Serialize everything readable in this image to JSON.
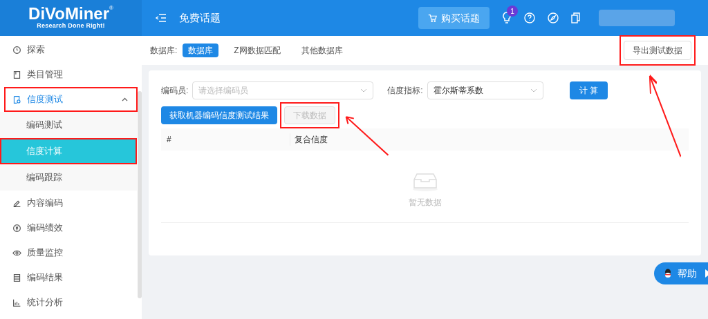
{
  "logo": {
    "name": "DiVoMiner",
    "mark": "®",
    "tagline": "Research Done Right!"
  },
  "header": {
    "title": "免费话题",
    "buy_button": "购买话题",
    "notification_count": "1"
  },
  "sidebar": {
    "items": [
      {
        "label": "探索",
        "selected": false,
        "highlighted": false
      },
      {
        "label": "类目管理",
        "selected": false,
        "highlighted": false
      },
      {
        "label": "信度测试",
        "selected": false,
        "highlighted": true,
        "expanded": true,
        "children": [
          {
            "label": "编码测试",
            "selected": false,
            "highlighted": false
          },
          {
            "label": "信度计算",
            "selected": true,
            "highlighted": true
          },
          {
            "label": "编码跟踪",
            "selected": false,
            "highlighted": false
          }
        ]
      },
      {
        "label": "内容编码",
        "selected": false,
        "highlighted": false
      },
      {
        "label": "编码绩效",
        "selected": false,
        "highlighted": false
      },
      {
        "label": "质量监控",
        "selected": false,
        "highlighted": false
      },
      {
        "label": "编码结果",
        "selected": false,
        "highlighted": false
      },
      {
        "label": "统计分析",
        "selected": false,
        "highlighted": false
      }
    ]
  },
  "database_bar": {
    "label": "数据库:",
    "options": [
      {
        "label": "数据库",
        "selected": true
      },
      {
        "label": "Z网数据匹配",
        "selected": false
      },
      {
        "label": "其他数据库",
        "selected": false
      }
    ],
    "export_button": {
      "label": "导出测试数据",
      "highlighted": true
    }
  },
  "form": {
    "coder": {
      "label": "编码员:",
      "placeholder": "请选择编码员"
    },
    "metric": {
      "label": "信度指标:",
      "value": "霍尔斯蒂系数"
    },
    "calculate_button": "计 算",
    "fetch_button": "获取机器编码信度测试结果",
    "download_button": {
      "label": "下载数据",
      "disabled": true,
      "highlighted": true
    }
  },
  "table": {
    "columns": [
      "#",
      "复合信度"
    ],
    "empty_text": "暂无数据"
  },
  "help_button": "帮助"
}
